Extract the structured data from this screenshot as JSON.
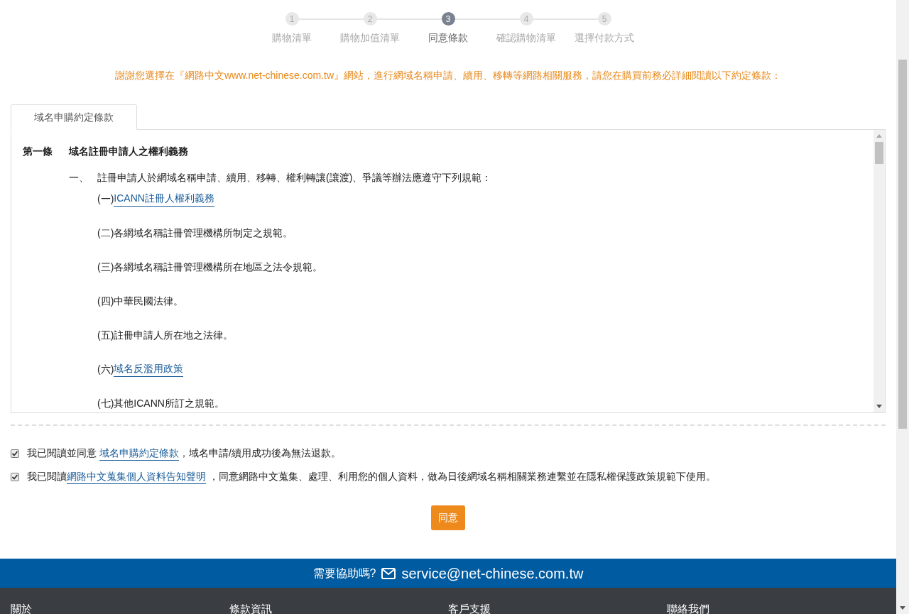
{
  "steps": [
    {
      "number": "1",
      "label": "購物清單",
      "selected": false
    },
    {
      "number": "2",
      "label": "購物加值清單",
      "selected": false
    },
    {
      "number": "3",
      "label": "同意條款",
      "selected": true
    },
    {
      "number": "4",
      "label": "確認購物清單",
      "selected": false
    },
    {
      "number": "5",
      "label": "選擇付款方式",
      "selected": false
    }
  ],
  "intro": "謝謝您選擇在『網路中文www.net-chinese.com.tw』網站，進行網域名稱申請、續用、移轉等網路相關服務，請您在購買前務必詳細閱讀以下約定條款：",
  "terms_tabs": [
    {
      "label": "域名申購約定條款",
      "selected": true
    }
  ],
  "terms": {
    "article_number": "第一條",
    "article_title": "域名註冊申請人之權利義務",
    "clause_marker": "一、",
    "clause_text": "註冊申請人於網域名稱申請、續用、移轉、權利轉讓(讓渡)、爭議等辦法應遵守下列規範：",
    "items": [
      {
        "marker": "(一)",
        "text": "ICANN註冊人權利義務",
        "kind": "link"
      },
      {
        "marker": "(二)",
        "text": "各網域名稱註冊管理機構所制定之規範。",
        "kind": "text"
      },
      {
        "marker": "(三)",
        "text": "各網域名稱註冊管理機構所在地區之法令規範。",
        "kind": "text"
      },
      {
        "marker": "(四)",
        "text": "中華民國法律。",
        "kind": "text"
      },
      {
        "marker": "(五)",
        "text": "註冊申請人所在地之法律。",
        "kind": "text"
      },
      {
        "marker": "(六)",
        "text": "域名反濫用政策",
        "kind": "link"
      },
      {
        "marker": "(七)",
        "text": "其他ICANN所訂之規範。",
        "kind": "text"
      }
    ]
  },
  "agreements": [
    {
      "checked": true,
      "before": "我已閱讀並同意 ",
      "link": "域名申購約定條款",
      "after": "，域名申請/續用成功後為無法退款。"
    },
    {
      "checked": true,
      "before": "我已閱讀",
      "link": "網路中文蒐集個人資料告知聲明",
      "after": " ，同意網路中文蒐集、處理、利用您的個人資料，做為日後網域名稱相關業務連繫並在隱私權保護政策規範下使用。"
    }
  ],
  "agree_button": "同意",
  "help": {
    "label": "需要協助嗎?",
    "email": "service@net-chinese.com.tw"
  },
  "footer_columns": [
    "關於",
    "條款資訊",
    "客戶支援",
    "聯絡我們"
  ]
}
